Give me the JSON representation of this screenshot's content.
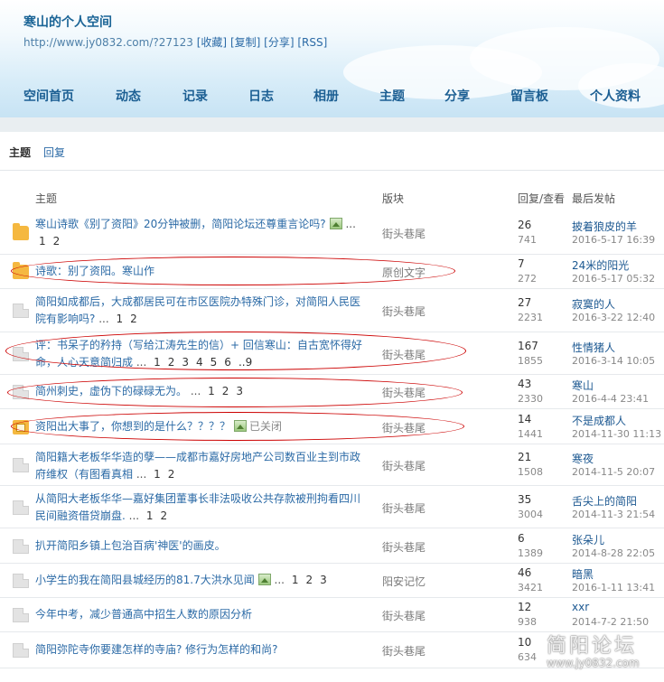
{
  "header": {
    "title": "寒山的个人空间",
    "url": "http://www.jy0832.com/?27123",
    "links": [
      "[收藏]",
      "[复制]",
      "[分享]",
      "[RSS]"
    ]
  },
  "nav": [
    "空间首页",
    "动态",
    "记录",
    "日志",
    "相册",
    "主题",
    "分享",
    "留言板",
    "个人资料"
  ],
  "tabs": {
    "active": "主题",
    "other": "回复"
  },
  "columns": {
    "subject": "主题",
    "forum": "版块",
    "stats": "回复/查看",
    "last": "最后发帖"
  },
  "rows": [
    {
      "title": "寒山诗歌《别了资阳》20分钟被删，简阳论坛还尊重言论吗?",
      "has_image": true,
      "closed": false,
      "pages": [
        "1",
        "2"
      ],
      "forum": "街头巷尾",
      "replies": "26",
      "views": "741",
      "last_user": "披着狼皮的羊",
      "last_date": "2016-5-17 16:39",
      "icon": "folder-hot"
    },
    {
      "title": "诗歌：别了资阳。寒山作",
      "has_image": false,
      "closed": false,
      "pages": [],
      "forum": "原创文字",
      "replies": "7",
      "views": "272",
      "last_user": "24米的阳光",
      "last_date": "2016-5-17 05:32",
      "icon": "folder-hot"
    },
    {
      "title": "简阳如成都后，大成都居民可在市区医院办特殊门诊，对简阳人民医院有影响吗?",
      "has_image": false,
      "closed": false,
      "pages": [
        "1",
        "2"
      ],
      "forum": "街头巷尾",
      "replies": "27",
      "views": "2231",
      "last_user": "寂寞的人",
      "last_date": "2016-3-22 12:40",
      "icon": "folder-gray"
    },
    {
      "title": "评：书呆子的矜持（写给江涛先生的信）+ 回信寒山：自古宽怀得好命，人心天意简归成",
      "has_image": false,
      "closed": false,
      "pages": [
        "1",
        "2",
        "3",
        "4",
        "5",
        "6",
        "..9"
      ],
      "forum": "街头巷尾",
      "replies": "167",
      "views": "1855",
      "last_user": "性情猪人",
      "last_date": "2016-3-14 10:05",
      "icon": "folder-gray"
    },
    {
      "title": "简州刺史，虚伪下的碌碌无为。",
      "has_image": false,
      "closed": false,
      "pages": [
        "1",
        "2",
        "3"
      ],
      "forum": "街头巷尾",
      "replies": "43",
      "views": "2330",
      "last_user": "寒山",
      "last_date": "2016-4-4 23:41",
      "icon": "folder-gray"
    },
    {
      "title": "资阳出大事了，你想到的是什么？？？？",
      "has_image": true,
      "closed": true,
      "closed_label": "已关闭",
      "pages": [],
      "forum": "街头巷尾",
      "replies": "14",
      "views": "1441",
      "last_user": "不是成都人",
      "last_date": "2014-11-30 11:13",
      "icon": "folder-lock"
    },
    {
      "title": "简阳籍大老板华华造的孽——成都市嘉好房地产公司数百业主到市政府维权（有图看真相",
      "has_image": false,
      "closed": false,
      "pages": [
        "1",
        "2"
      ],
      "forum": "街头巷尾",
      "replies": "21",
      "views": "1508",
      "last_user": "寒夜",
      "last_date": "2014-11-5 20:07",
      "icon": "folder-gray"
    },
    {
      "title": "从简阳大老板华华—嘉好集团董事长非法吸收公共存款被刑拘看四川民间融资借贷崩盘.",
      "has_image": false,
      "closed": false,
      "pages": [
        "1",
        "2"
      ],
      "forum": "街头巷尾",
      "replies": "35",
      "views": "3004",
      "last_user": "舌尖上的简阳",
      "last_date": "2014-11-3 21:54",
      "icon": "folder-gray"
    },
    {
      "title": "扒开简阳乡镇上包治百病'神医'的画皮。",
      "has_image": false,
      "closed": false,
      "pages": [],
      "forum": "街头巷尾",
      "replies": "6",
      "views": "1389",
      "last_user": "张朵儿",
      "last_date": "2014-8-28 22:05",
      "icon": "folder-gray"
    },
    {
      "title": "小学生的我在简阳县城经历的81.7大洪水见闻",
      "has_image": true,
      "closed": false,
      "pages": [
        "1",
        "2",
        "3"
      ],
      "forum": "阳安记忆",
      "replies": "46",
      "views": "3421",
      "last_user": "暗黑",
      "last_date": "2016-1-11 13:41",
      "icon": "folder-gray"
    },
    {
      "title": "今年中考，减少普通高中招生人数的原因分析",
      "has_image": false,
      "closed": false,
      "pages": [],
      "forum": "街头巷尾",
      "replies": "12",
      "views": "938",
      "last_user": "xxr",
      "last_date": "2014-7-2 21:50",
      "icon": "folder-gray"
    },
    {
      "title": "简阳弥陀寺你要建怎样的寺庙? 修行为怎样的和尚?",
      "has_image": false,
      "closed": false,
      "pages": [],
      "forum": "街头巷尾",
      "replies": "10",
      "views": "634",
      "last_user": "",
      "last_date": "",
      "icon": "folder-gray"
    }
  ],
  "watermark": {
    "line1": "简阳论坛",
    "line2": "www.jy0832.com"
  }
}
